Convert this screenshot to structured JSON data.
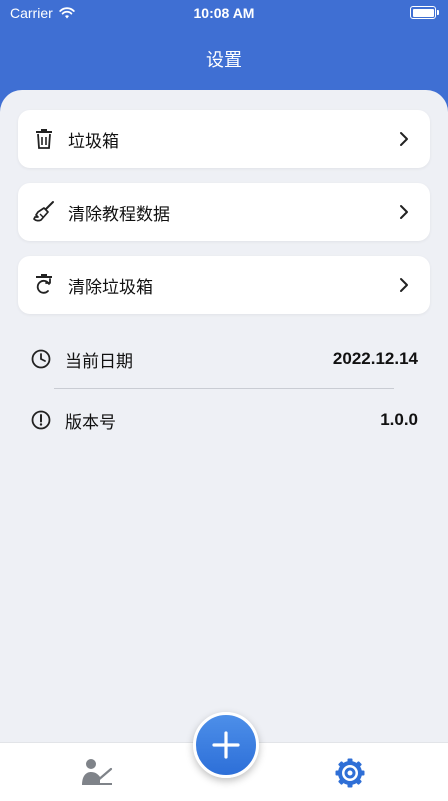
{
  "status_bar": {
    "carrier": "Carrier",
    "time": "10:08 AM"
  },
  "header": {
    "title": "设置"
  },
  "cards": [
    {
      "label": "垃圾箱",
      "icon": "trash-icon"
    },
    {
      "label": "清除教程数据",
      "icon": "broom-icon"
    },
    {
      "label": "清除垃圾箱",
      "icon": "refresh-trash-icon"
    }
  ],
  "info": {
    "date_label": "当前日期",
    "date_value": "2022.12.14",
    "version_label": "版本号",
    "version_value": "1.0.0"
  },
  "tab_bar": {
    "left_icon": "teacher-icon",
    "center_icon": "plus-icon",
    "right_icon": "gear-icon"
  },
  "colors": {
    "accent": "#3f6fd3",
    "tab_active": "#2f6fd6",
    "tab_inactive": "#7f8389"
  }
}
